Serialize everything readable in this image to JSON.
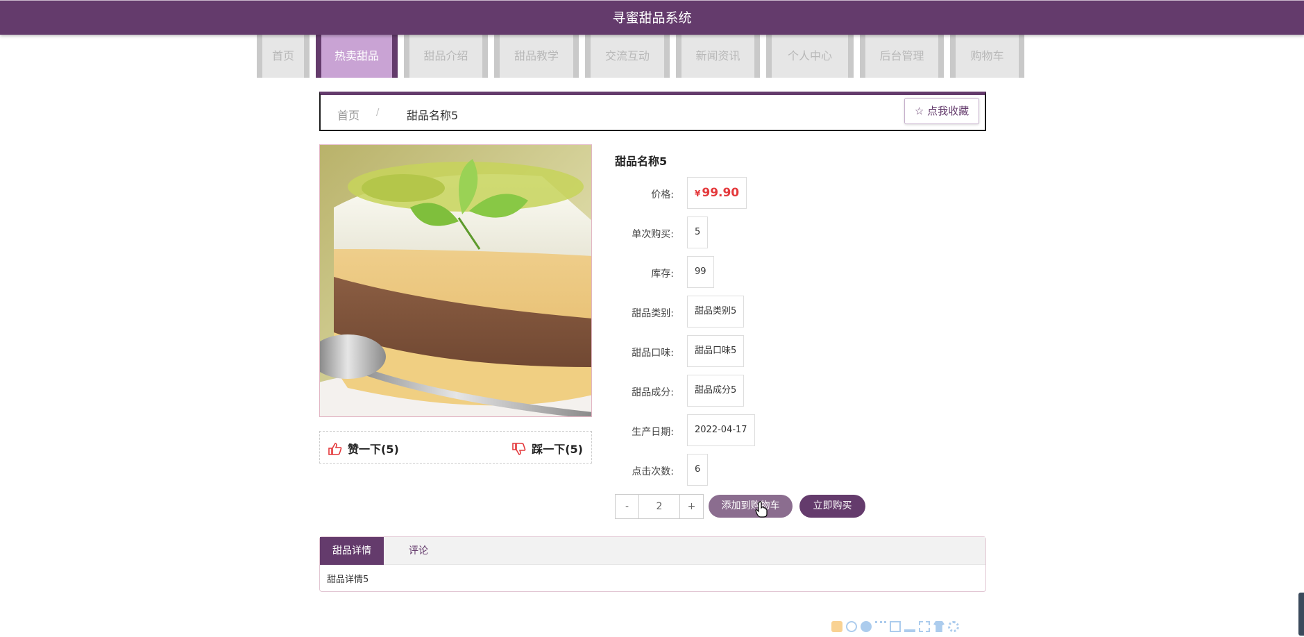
{
  "header": {
    "title": "寻蜜甜品系统"
  },
  "nav": {
    "items": [
      {
        "label": "首页",
        "width": 76,
        "active": false
      },
      {
        "label": "热卖甜品",
        "width": 118,
        "active": true
      },
      {
        "label": "甜品介绍",
        "width": 121,
        "active": false
      },
      {
        "label": "甜品教学",
        "width": 122,
        "active": false
      },
      {
        "label": "交流互动",
        "width": 122,
        "active": false
      },
      {
        "label": "新闻资讯",
        "width": 121,
        "active": false
      },
      {
        "label": "个人中心",
        "width": 126,
        "active": false
      },
      {
        "label": "后台管理",
        "width": 121,
        "active": false
      },
      {
        "label": "购物车",
        "width": 107,
        "active": false
      }
    ]
  },
  "breadcrumb": {
    "home": "首页",
    "separator": "/",
    "current": "甜品名称5"
  },
  "favorite": {
    "label": "点我收藏"
  },
  "votes": {
    "like": "赞一下(5)",
    "dislike": "踩一下(5)"
  },
  "product": {
    "name": "甜品名称5",
    "currency": "¥",
    "price": "99.90",
    "price_label": "价格:",
    "fields": [
      {
        "label": "单次购买:",
        "value": "5"
      },
      {
        "label": "库存:",
        "value": "99"
      },
      {
        "label": "甜品类别:",
        "value": "甜品类别5"
      },
      {
        "label": "甜品口味:",
        "value": "甜品口味5"
      },
      {
        "label": "甜品成分:",
        "value": "甜品成分5"
      },
      {
        "label": "生产日期:",
        "value": "2022-04-17"
      },
      {
        "label": "点击次数:",
        "value": "6"
      }
    ]
  },
  "quantity": {
    "minus": "-",
    "value": "2",
    "plus": "+"
  },
  "actions": {
    "add_to_cart": "添加到购物车",
    "buy_now": "立即购买"
  },
  "tabs": {
    "detail": "甜品详情",
    "comments": "评论",
    "content": "甜品详情5"
  },
  "colors": {
    "brand": "#643b6c",
    "active_nav": "#c9a3d4",
    "price": "#e4393c"
  }
}
